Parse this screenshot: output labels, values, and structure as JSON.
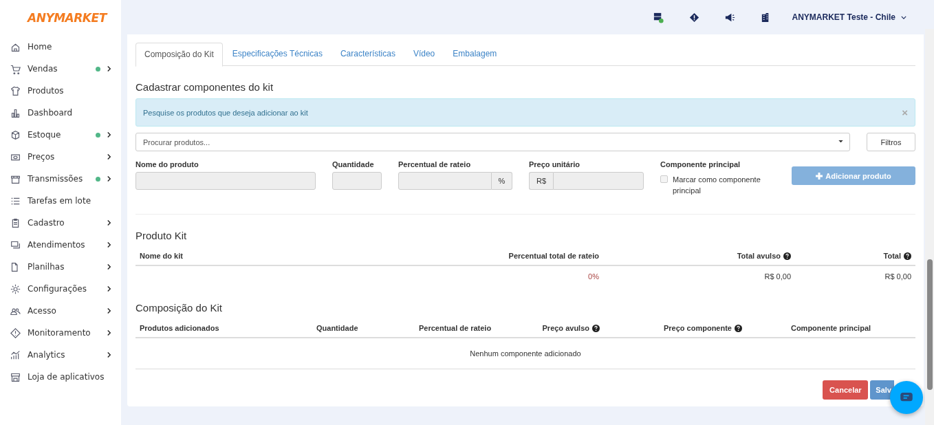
{
  "brand": "ANYMARKET",
  "sidebar": {
    "items": [
      {
        "label": "Home",
        "status_dot": false,
        "expandable": false
      },
      {
        "label": "Vendas",
        "status_dot": true,
        "expandable": true
      },
      {
        "label": "Produtos",
        "status_dot": false,
        "expandable": false
      },
      {
        "label": "Dashboard",
        "status_dot": false,
        "expandable": false
      },
      {
        "label": "Estoque",
        "status_dot": true,
        "expandable": true
      },
      {
        "label": "Preços",
        "status_dot": false,
        "expandable": true
      },
      {
        "label": "Transmissões",
        "status_dot": true,
        "expandable": true
      },
      {
        "label": "Tarefas em lote",
        "status_dot": false,
        "expandable": false
      },
      {
        "label": "Cadastro",
        "status_dot": false,
        "expandable": true
      },
      {
        "label": "Atendimentos",
        "status_dot": false,
        "expandable": true
      },
      {
        "label": "Planilhas",
        "status_dot": false,
        "expandable": true
      },
      {
        "label": "Configurações",
        "status_dot": false,
        "expandable": true
      },
      {
        "label": "Acesso",
        "status_dot": false,
        "expandable": true
      },
      {
        "label": "Monitoramento",
        "status_dot": false,
        "expandable": true
      },
      {
        "label": "Analytics",
        "status_dot": false,
        "expandable": true
      },
      {
        "label": "Loja de aplicativos",
        "status_dot": false,
        "expandable": false
      }
    ]
  },
  "topbar": {
    "account": "ANYMARKET Teste - Chile"
  },
  "tabs": [
    {
      "label": "Composição do Kit",
      "selected": true
    },
    {
      "label": "Especificações Técnicas",
      "selected": false
    },
    {
      "label": "Características",
      "selected": false
    },
    {
      "label": "Vídeo",
      "selected": false
    },
    {
      "label": "Embalagem",
      "selected": false
    }
  ],
  "register": {
    "title": "Cadastrar componentes do kit",
    "alert": "Pesquise os produtos que deseja adicionar ao kit",
    "alert_close": "×",
    "search": {
      "placeholder": "Procurar produtos..."
    },
    "filter_button": "Filtros",
    "fields": {
      "name_label": "Nome do produto",
      "quantity_label": "Quantidade",
      "share_label": "Percentual de rateio",
      "share_suffix": "%",
      "price_label": "Preço unitário",
      "price_prefix": "R$",
      "main_label": "Componente principal",
      "main_checkbox": {
        "label": "Marcar como componente principal",
        "checked": false
      }
    },
    "add_button": "Adicionar produto"
  },
  "kit": {
    "title": "Produto Kit",
    "columns": [
      {
        "label": "Nome do kit",
        "help": false
      },
      {
        "label": "Percentual total de rateio",
        "help": false
      },
      {
        "label": "Total avulso",
        "help": true
      },
      {
        "label": "Total",
        "help": true
      }
    ],
    "row": {
      "share": "0%",
      "total_loose": "R$ 0,00",
      "total": "R$ 0,00"
    }
  },
  "composition": {
    "title": "Composição do Kit",
    "columns": [
      {
        "label": "Produtos adicionados",
        "help": false
      },
      {
        "label": "Quantidade",
        "help": false
      },
      {
        "label": "Percentual de rateio",
        "help": false
      },
      {
        "label": "Preço avulso",
        "help": true
      },
      {
        "label": "Preço componente",
        "help": true
      },
      {
        "label": "Componente principal",
        "help": false
      }
    ],
    "empty": "Nenhum componente adicionado"
  },
  "footer": {
    "cancel": "Cancelar",
    "save": "Salv"
  }
}
